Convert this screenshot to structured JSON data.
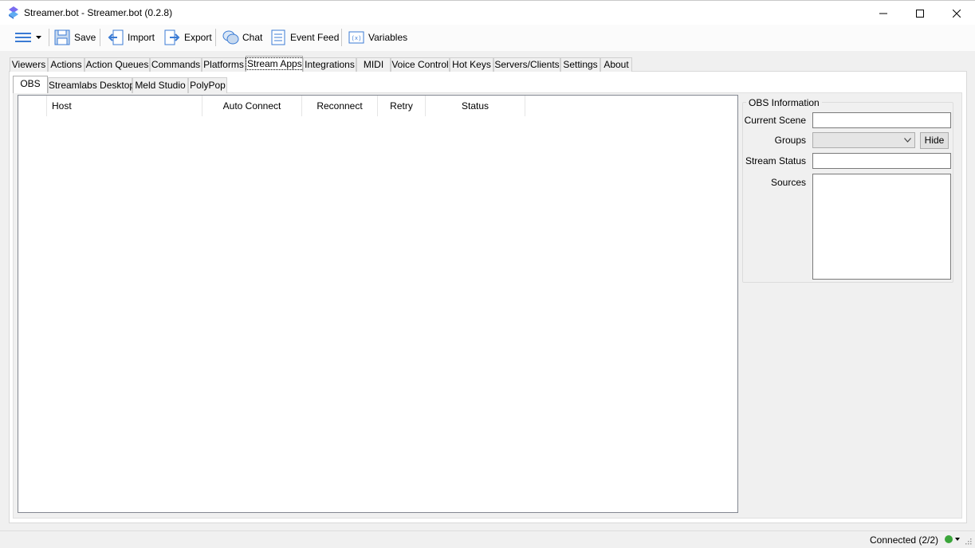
{
  "window": {
    "title": "Streamer.bot - Streamer.bot (0.2.8)",
    "minimize_icon": "minimize-icon",
    "maximize_icon": "maximize-icon",
    "close_icon": "close-icon"
  },
  "toolbar": {
    "menu_icon": "hamburger-menu-icon",
    "save": "Save",
    "import": "Import",
    "export": "Export",
    "chat": "Chat",
    "event_feed": "Event Feed",
    "variables": "Variables"
  },
  "main_tabs": [
    "Viewers",
    "Actions",
    "Action Queues",
    "Commands",
    "Platforms",
    "Stream Apps",
    "Integrations",
    "MIDI",
    "Voice Control",
    "Hot Keys",
    "Servers/Clients",
    "Settings",
    "About"
  ],
  "main_tabs_active": "Stream Apps",
  "sub_tabs": [
    "OBS",
    "Streamlabs Desktop",
    "Meld Studio",
    "PolyPop"
  ],
  "sub_tabs_active": "OBS",
  "obs_list": {
    "columns": [
      "",
      "Host",
      "Auto Connect",
      "Reconnect",
      "Retry",
      "Status"
    ]
  },
  "obs_info": {
    "title": "OBS Information",
    "current_scene_label": "Current Scene",
    "current_scene_value": "",
    "groups_label": "Groups",
    "groups_selected": "",
    "hide_button": "Hide",
    "stream_status_label": "Stream Status",
    "stream_status_value": "",
    "sources_label": "Sources"
  },
  "status_bar": {
    "connection_text": "Connected (2/2)",
    "status_color": "#3aa53a"
  },
  "colors": {
    "accent_blue": "#3b7bd4",
    "icon_purple": "#6b5bd6"
  }
}
